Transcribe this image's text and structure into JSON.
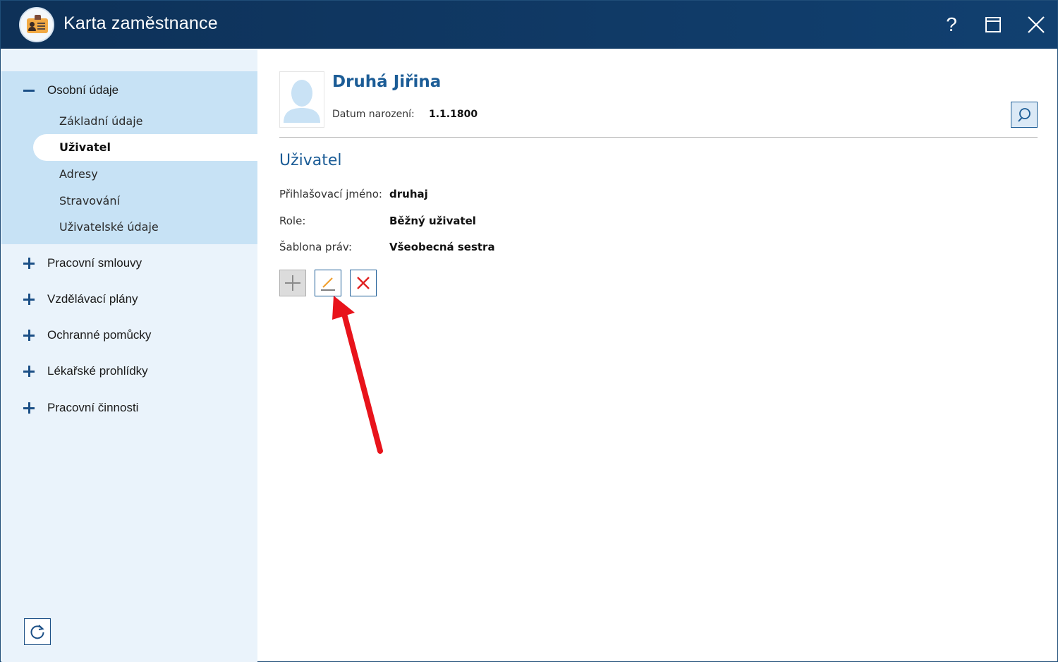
{
  "window": {
    "title": "Karta zaměstnance",
    "help_label": "?"
  },
  "sidebar": {
    "sections": [
      {
        "label": "Osobní údaje",
        "expanded": true
      },
      {
        "label": "Pracovní smlouvy",
        "expanded": false
      },
      {
        "label": "Vzdělávací plány",
        "expanded": false
      },
      {
        "label": "Ochranné pomůcky",
        "expanded": false
      },
      {
        "label": "Lékařské prohlídky",
        "expanded": false
      },
      {
        "label": "Pracovní činnosti",
        "expanded": false
      }
    ],
    "subitems": [
      {
        "label": "Základní údaje"
      },
      {
        "label": "Uživatel",
        "active": true
      },
      {
        "label": "Adresy"
      },
      {
        "label": "Stravování"
      },
      {
        "label": "Uživatelské údaje"
      }
    ]
  },
  "employee": {
    "name": "Druhá Jiřina",
    "dob_label": "Datum narození:",
    "dob_value": "1.1.1800"
  },
  "user_section": {
    "title": "Uživatel",
    "fields": [
      {
        "label": "Přihlašovací jméno:",
        "value": "druhaj"
      },
      {
        "label": "Role:",
        "value": "Běžný uživatel"
      },
      {
        "label": "Šablona práv:",
        "value": "Všeobecná sestra"
      }
    ]
  },
  "colors": {
    "titlebar": "#0e3158",
    "accent": "#1b5c96",
    "sidebar_bg": "#eaf3fb",
    "sidebar_group": "#c7e2f5",
    "annotation_arrow": "#e8131b"
  },
  "icons": [
    "app-icon",
    "help-icon",
    "maximize-icon",
    "close-icon",
    "minus-icon",
    "plus-icon",
    "refresh-icon",
    "avatar-placeholder-icon",
    "search-icon",
    "add-icon",
    "edit-icon",
    "delete-icon"
  ]
}
